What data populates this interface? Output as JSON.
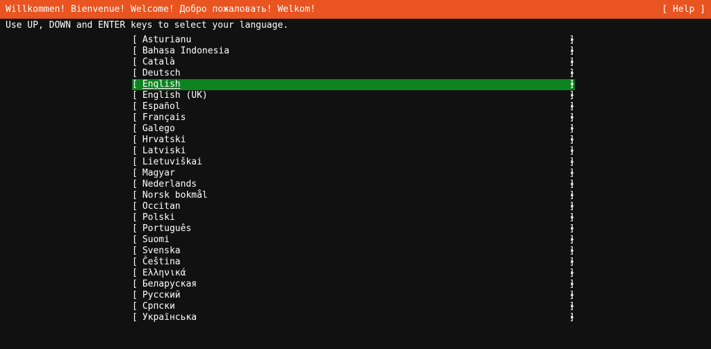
{
  "header": {
    "greeting": "Willkommen! Bienvenue! Welcome! Добро пожаловать! Welkom!",
    "help_label": "[ Help ]",
    "background_color": "#e95420",
    "text_color": "#ffffff"
  },
  "instruction": {
    "text": "Use UP, DOWN and ENTER keys to select your language."
  },
  "list": {
    "bracket_open": "[",
    "bracket_close": "]",
    "submenu_icon": "▸",
    "selected_index": 4,
    "highlight_color": "#0e8420",
    "background_color": "#111111",
    "items": [
      {
        "label": "Asturianu"
      },
      {
        "label": "Bahasa Indonesia"
      },
      {
        "label": "Català"
      },
      {
        "label": "Deutsch"
      },
      {
        "label": "English"
      },
      {
        "label": "English (UK)"
      },
      {
        "label": "Español"
      },
      {
        "label": "Français"
      },
      {
        "label": "Galego"
      },
      {
        "label": "Hrvatski"
      },
      {
        "label": "Latviski"
      },
      {
        "label": "Lietuviškai"
      },
      {
        "label": "Magyar"
      },
      {
        "label": "Nederlands"
      },
      {
        "label": "Norsk bokmål"
      },
      {
        "label": "Occitan"
      },
      {
        "label": "Polski"
      },
      {
        "label": "Português"
      },
      {
        "label": "Suomi"
      },
      {
        "label": "Svenska"
      },
      {
        "label": "Čeština"
      },
      {
        "label": "Ελληνικά"
      },
      {
        "label": "Беларуская"
      },
      {
        "label": "Русский"
      },
      {
        "label": "Српски"
      },
      {
        "label": "Українська"
      }
    ]
  }
}
